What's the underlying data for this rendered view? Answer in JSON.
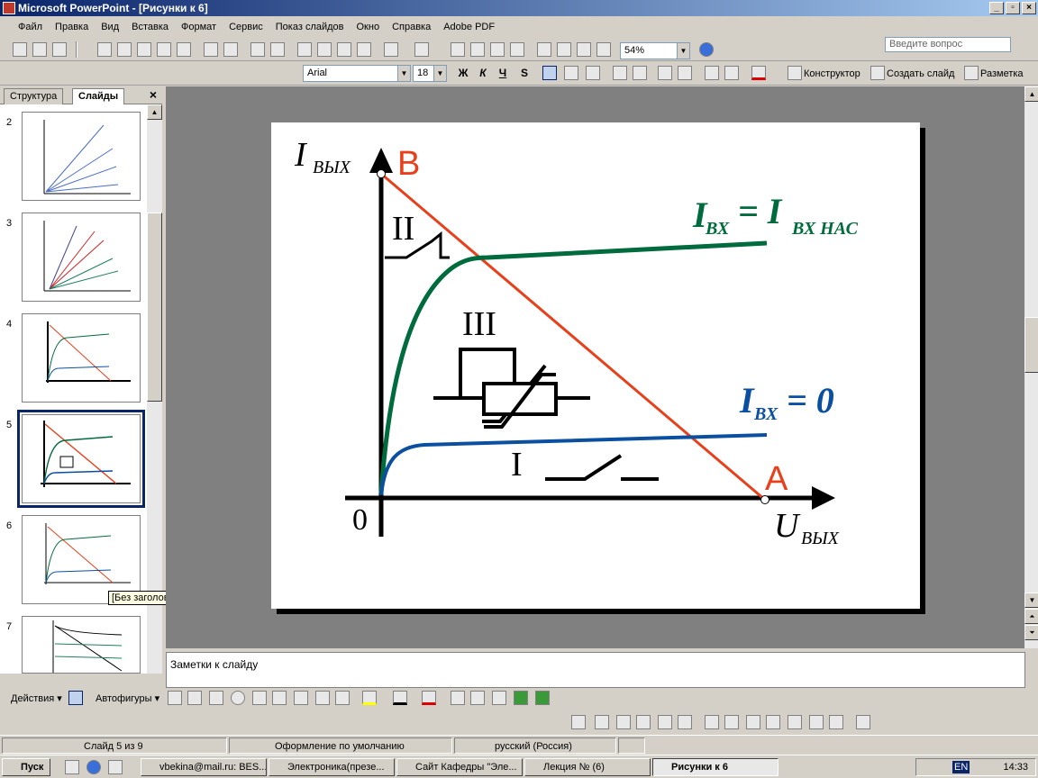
{
  "window": {
    "title": "Microsoft PowerPoint - [Рисунки к 6]",
    "min": "_",
    "max": "▫",
    "close": "×"
  },
  "menu": [
    "Файл",
    "Правка",
    "Вид",
    "Вставка",
    "Формат",
    "Сервис",
    "Показ слайдов",
    "Окно",
    "Справка",
    "Adobe PDF"
  ],
  "ask_placeholder": "Введите вопрос",
  "toolbar": {
    "zoom": "54%"
  },
  "format": {
    "font": "Arial",
    "size": "18",
    "bold": "Ж",
    "italic": "К",
    "underline": "Ч",
    "shadow": "S",
    "designer": "Конструктор",
    "new_slide": "Создать слайд",
    "layout": "Разметка"
  },
  "panel": {
    "tab_outline": "Структура",
    "tab_slides": "Слайды",
    "close": "×",
    "thumbs": [
      "2",
      "3",
      "4",
      "5",
      "6",
      "7"
    ],
    "tooltip": "[Без заголовка]"
  },
  "slide": {
    "y_axis": "I",
    "y_sub": "ВЫХ",
    "x_axis": "U",
    "x_sub": "ВЫХ",
    "origin": "0",
    "point_b": "B",
    "point_a": "A",
    "curve_sat_lhs": "I",
    "curve_sat_lhs_sub": "ВХ",
    "curve_sat_eq": "= I",
    "curve_sat_rhs_sub": "ВХ НАС",
    "curve_zero": "I",
    "curve_zero_sub": "ВХ",
    "curve_zero_eq": "= 0",
    "region_1": "I",
    "region_2": "II",
    "region_3": "III",
    "colors": {
      "green": "#006b3c",
      "blue": "#0a4fa0",
      "red": "#e8401a"
    }
  },
  "notes": "Заметки к слайду",
  "draw": {
    "actions": "Действия ▾",
    "autoshapes": "Автофигуры ▾"
  },
  "status": {
    "slide": "Слайд 5 из 9",
    "design": "Оформление по умолчанию",
    "lang": "русский (Россия)"
  },
  "taskbar": {
    "start": "Пуск",
    "tasks": [
      "vbekina@mail.ru: BES...",
      "Электроника(презе...",
      "Сайт Кафедры \"Эле...",
      "Лекция № (6)",
      "Рисунки к 6"
    ],
    "lang": "EN",
    "time": "14:33"
  }
}
